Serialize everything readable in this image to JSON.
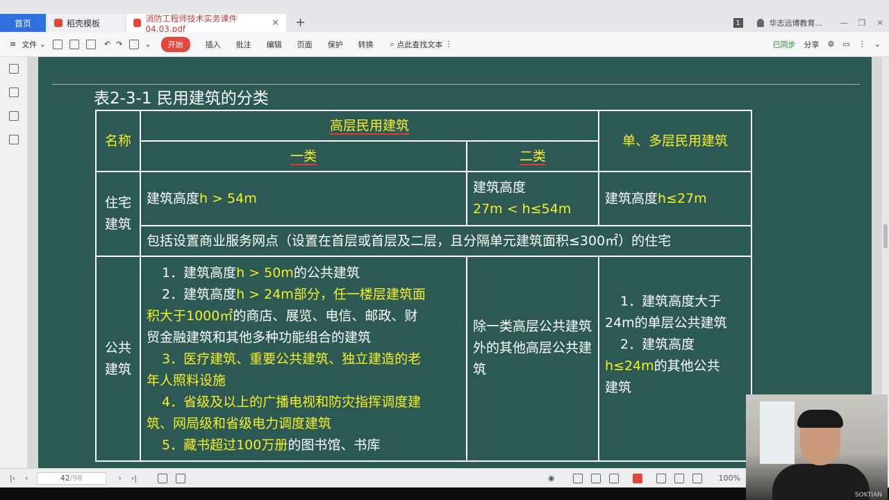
{
  "tabs": {
    "home": "首页",
    "tab1": "稻壳模板",
    "tab2": "消防工程师技术实务课件04.03.pdf",
    "add": "+",
    "page_badge": "1",
    "account": "华志远博教育..."
  },
  "toolbar": {
    "file": "文件",
    "start": "开始",
    "insert": "插入",
    "annotate": "批注",
    "edit": "编辑",
    "page": "页面",
    "protect": "保护",
    "convert": "转换",
    "search": "点此查找文本",
    "synced": "已同步",
    "share": "分享"
  },
  "slide": {
    "title": "表2-3-1  民用建筑的分类",
    "header_name": "名称",
    "header_high": "高层民用建筑",
    "header_class1": "一类",
    "header_class2": "二类",
    "header_low": "单、多层民用建筑",
    "res_label_1": "住宅",
    "res_label_2": "建筑",
    "res_c1_prefix": "建筑高度",
    "res_c1_val": "h > 54m",
    "res_c2_line1": "建筑高度",
    "res_c2_val": "27m < h≤54m",
    "res_c3_prefix": "建筑高度",
    "res_c3_val": "h≤27m",
    "res_note": "包括设置商业服务网点（设置在首层或首层及二层，且分隔单元建筑面积≤300㎡）的住宅",
    "pub_label_1": "公共",
    "pub_label_2": "建筑",
    "pub_c1": {
      "l1a": "1．建筑高度",
      "l1b": "h > 50m",
      "l1c": "的公共建筑",
      "l2a": "2．建筑高度",
      "l2b": "h > 24m部分，任一楼层建筑面",
      "l3a": "积大于1000㎡",
      "l3b": "的商店、展览、电信、邮政、财",
      "l4": "贸金融建筑和其他多种功能组合的建筑",
      "l5": "3．医疗建筑、重要公共建筑、独立建造的老",
      "l6": "年人照料设施",
      "l7": "4．省级及以上的广播电视和防灾指挥调度建",
      "l8": "筑、网局级和省级电力调度建筑",
      "l9a": "5．藏书超过100万册",
      "l9b": "的图书馆、书库"
    },
    "pub_c2": "除一类高层公共建筑外的其他高层公共建筑",
    "pub_c3": {
      "l1": "1．建筑高度大于",
      "l2": "24m的单层公共建筑",
      "l3": "2．建筑高度",
      "l4a": "h≤24m",
      "l4b": "的其他公共",
      "l5": "建筑"
    }
  },
  "status": {
    "page_current": "42",
    "page_total": "/98",
    "zoom": "100%"
  },
  "watermark": "SOKTIAN"
}
